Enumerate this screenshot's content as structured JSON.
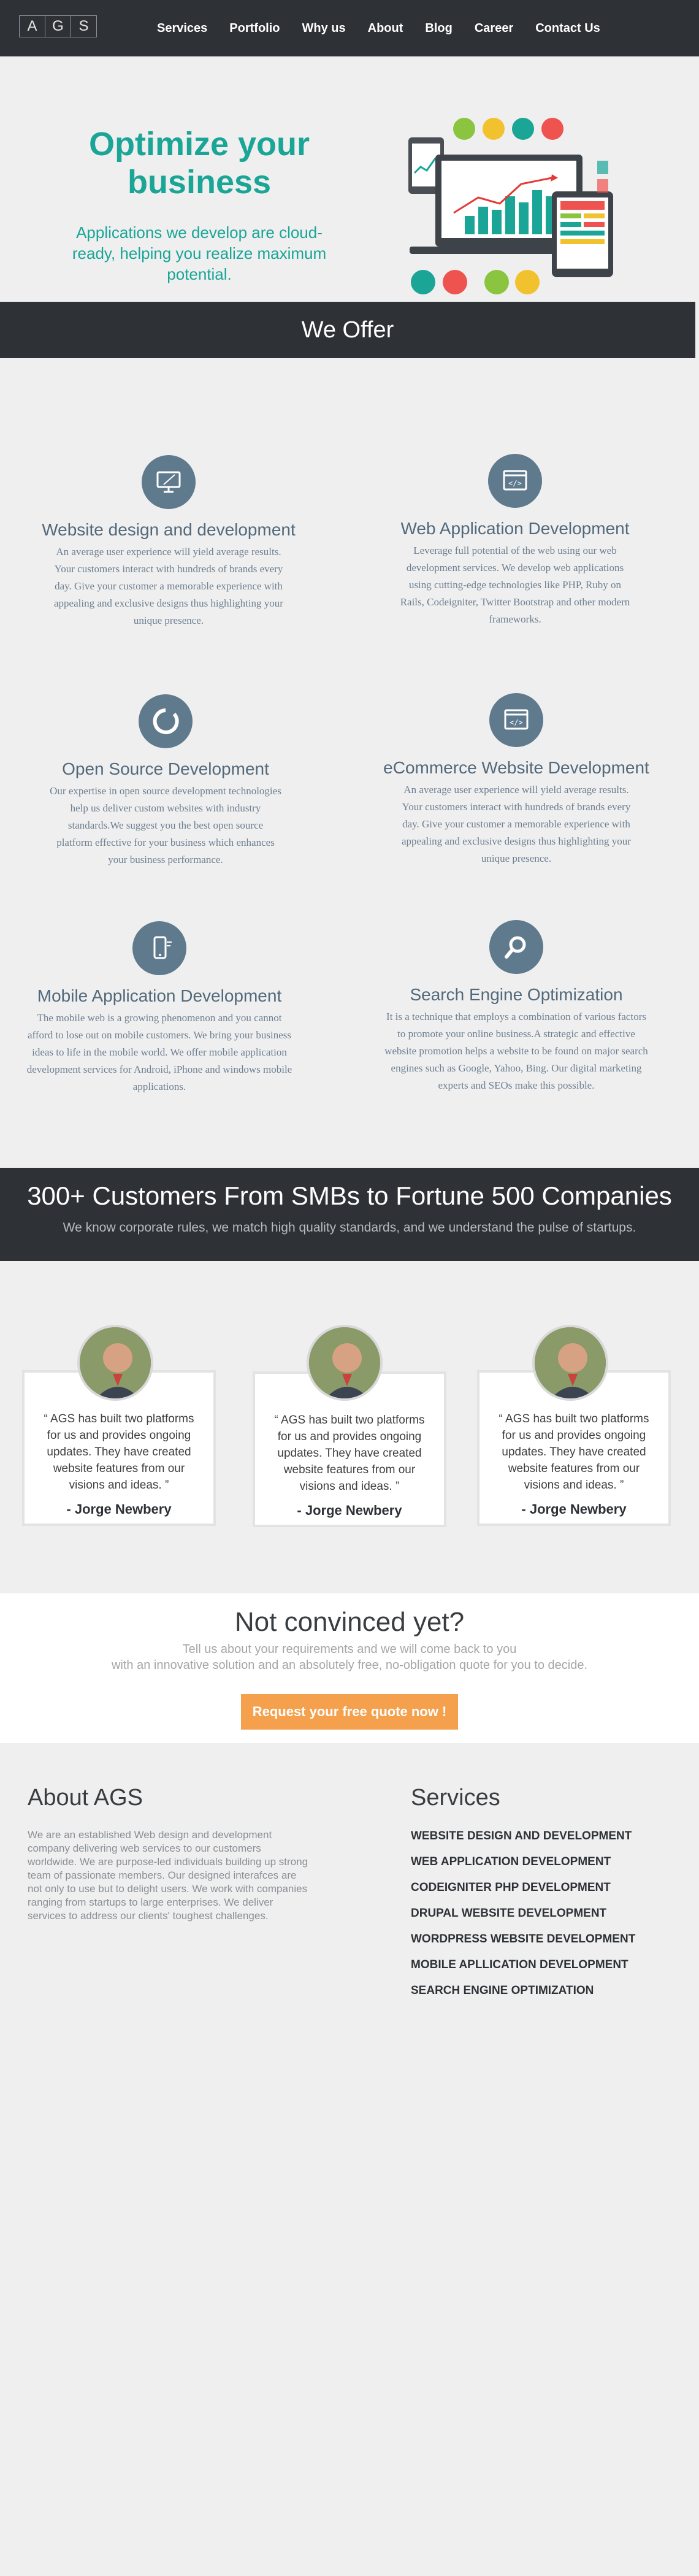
{
  "nav": {
    "logo_letters": [
      "A",
      "G",
      "S"
    ],
    "links": [
      "Services",
      "Portfolio",
      "Why us",
      "About",
      "Blog",
      "Career",
      "Contact Us"
    ]
  },
  "hero": {
    "title": "Optimize your business",
    "subtitle": "Applications we develop are cloud-ready, helping you realize maximum potential."
  },
  "offer": {
    "heading": "We Offer",
    "services": [
      {
        "title": "Website design and development",
        "icon": "monitor-icon",
        "text": "An average user experience will yield average results. Your customers interact with hundreds of brands every day. Give your customer a memorable experience with appealing and exclusive designs  thus highlighting your unique presence."
      },
      {
        "title": "Web Application Development",
        "icon": "code-window-icon",
        "text": "Leverage full potential of the web using our web development services. We develop web applications using cutting-edge technologies like PHP, Ruby on Rails, Codeigniter, Twitter Bootstrap and other modern frameworks."
      },
      {
        "title": "Open Source Development",
        "icon": "ring-icon",
        "text": "Our expertise in open source development technologies help us deliver custom websites with industry standards.We suggest you the best open source platform effective for your business  which enhances your business performance."
      },
      {
        "title": "eCommerce Website Development",
        "icon": "code-window-icon",
        "text": "An average user experience will yield average results. Your customers interact with hundreds of brands every day. Give your customer a memorable experience with appealing and exclusive designs  thus highlighting your unique presence."
      },
      {
        "title": "Mobile Application Development",
        "icon": "mobile-phone-icon",
        "text": "The mobile web is a growing phenomenon and you cannot afford to lose out on mobile customers. We bring your business ideas  to life in the mobile world. We offer mobile application development services for Android, iPhone and windows mobile applications."
      },
      {
        "title": "Search Engine Optimization",
        "icon": "magnifier-icon",
        "text": "It is a technique that employs a combination of various factors to promote your online business.A strategic and effective website promotion helps a website to be found on major search engines such as Google, Yahoo, Bing. Our digital marketing experts and SEOs make this possible."
      }
    ]
  },
  "customers": {
    "heading": "300+ Customers From SMBs to Fortune 500 Companies",
    "subheading": "We know corporate rules, we match high quality standards, and we understand the pulse of startups."
  },
  "testimonials": [
    {
      "quote": "“ AGS has built two platforms for us and provides ongoing updates. They have created website features from our visions and ideas. ”",
      "author": "- Jorge Newbery"
    },
    {
      "quote": "“ AGS has built two platforms for us and provides ongoing updates. They have created website features from our visions and ideas. ”",
      "author": "- Jorge Newbery"
    },
    {
      "quote": "“ AGS has built two platforms for us and provides ongoing updates. They have created website features from our visions and ideas. ”",
      "author": "- Jorge Newbery"
    }
  ],
  "cta": {
    "heading": "Not convinced yet?",
    "line1": "Tell us about your requirements and we will come back to you",
    "line2": "with an innovative solution and an absolutely free, no-obligation quote for you to decide.",
    "button": "Request your free quote now !"
  },
  "about": {
    "heading": "About AGS",
    "text": "We are an established Web design and development company delivering web services to our customers worldwide. We are purpose-led individuals building up strong team of passionate members. Our designed interafces are not only to use but to delight users. We work with companies ranging from startups to large enterprises. We deliver services to address our clients' toughest challenges."
  },
  "footer_services": {
    "heading": "Services",
    "items": [
      "WEBSITE DESIGN AND DEVELOPMENT",
      "WEB APPLICATION DEVELOPMENT",
      "CODEIGNITER PHP DEVELOPMENT",
      "DRUPAL WEBSITE DEVELOPMENT",
      "WORDPRESS WEBSITE DEVELOPMENT",
      "MOBILE APLLICATION DEVELOPMENT",
      "SEARCH ENGINE OPTIMIZATION"
    ]
  },
  "colors": {
    "dark_bar": "#2e3136",
    "teal": "#1aa597",
    "icon_circle": "#5f7a8d",
    "cta_orange": "#f5a04c"
  }
}
